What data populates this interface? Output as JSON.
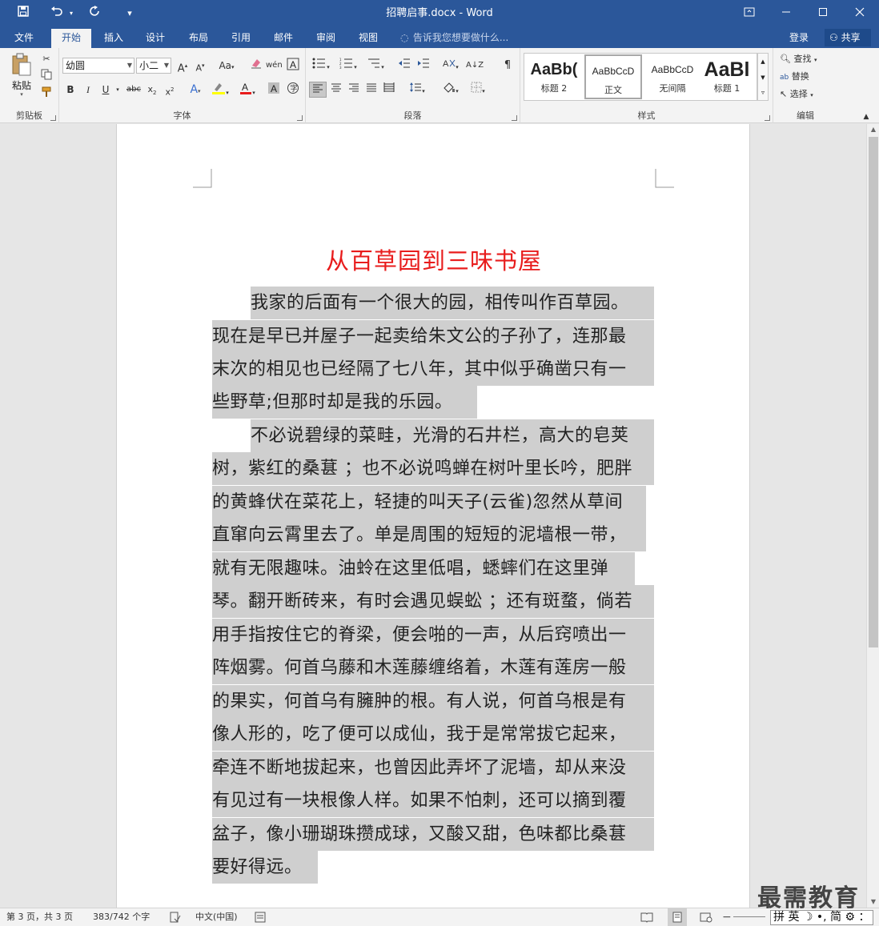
{
  "window": {
    "title": "招聘启事.docx - Word"
  },
  "quick_access": {
    "save_icon": "save-icon",
    "undo_icon": "undo-icon",
    "redo_icon": "redo-icon",
    "customize_icon": "customize-icon"
  },
  "tabs": [
    {
      "label": "文件"
    },
    {
      "label": "开始"
    },
    {
      "label": "插入"
    },
    {
      "label": "设计"
    },
    {
      "label": "布局"
    },
    {
      "label": "引用"
    },
    {
      "label": "邮件"
    },
    {
      "label": "审阅"
    },
    {
      "label": "视图"
    }
  ],
  "tell_me": "告诉我您想要做什么...",
  "account": {
    "login": "登录",
    "share": "共享"
  },
  "ribbon": {
    "clipboard": {
      "label": "剪贴板",
      "paste": "粘贴"
    },
    "font": {
      "label": "字体",
      "font_name": "幼圆",
      "font_size": "小二",
      "change_case": "Aa"
    },
    "paragraph": {
      "label": "段落"
    },
    "styles": {
      "label": "样式",
      "items": [
        {
          "preview": "AaBb(",
          "name": "标题 2"
        },
        {
          "preview": "AaBbCcD",
          "name": "正文"
        },
        {
          "preview": "AaBbCcD",
          "name": "无间隔"
        },
        {
          "preview": "AaBl",
          "name": "标题 1"
        }
      ]
    },
    "editing": {
      "label": "编辑",
      "find": "查找",
      "replace": "替换",
      "select": "选择"
    }
  },
  "document": {
    "heading": "从百草园到三味书屋",
    "lines": [
      "我家的后面有一个很大的园，相传叫作百草园。",
      "现在是早已并屋子一起卖给朱文公的子孙了，连那最",
      "末次的相见也已经隔了七八年，其中似乎确凿只有一",
      "些野草;但那时却是我的乐园。",
      "不必说碧绿的菜畦，光滑的石井栏，高大的皂荚",
      "树，紫红的桑葚 ；也不必说鸣蝉在树叶里长吟，肥胖",
      "的黄蜂伏在菜花上，轻捷的叫天子(云雀)忽然从草间",
      "直窜向云霄里去了。单是周围的短短的泥墙根一带，",
      "就有无限趣味。油蛉在这里低唱，蟋蟀们在这里弹",
      "琴。翻开断砖来，有时会遇见蜈蚣 ；还有斑蝥，倘若",
      "用手指按住它的脊梁，便会啪的一声，从后窍喷出一",
      "阵烟雾。何首乌藤和木莲藤缠络着，木莲有莲房一般",
      "的果实，何首乌有臃肿的根。有人说，何首乌根是有",
      "像人形的，吃了便可以成仙，我于是常常拔它起来，",
      "牵连不断地拔起来，也曾因此弄坏了泥墙，却从来没",
      "有见过有一块根像人样。如果不怕刺，还可以摘到覆",
      "盆子，像小珊瑚珠攒成球，又酸又甜，色味都比桑葚",
      "要好得远。"
    ]
  },
  "status": {
    "page": "第 3 页，共 3 页",
    "words": "383/742 个字",
    "language": "中文(中国)"
  },
  "watermark": "最需教育",
  "ime": "拼 英 ☽ •, 简 ⚙ ："
}
